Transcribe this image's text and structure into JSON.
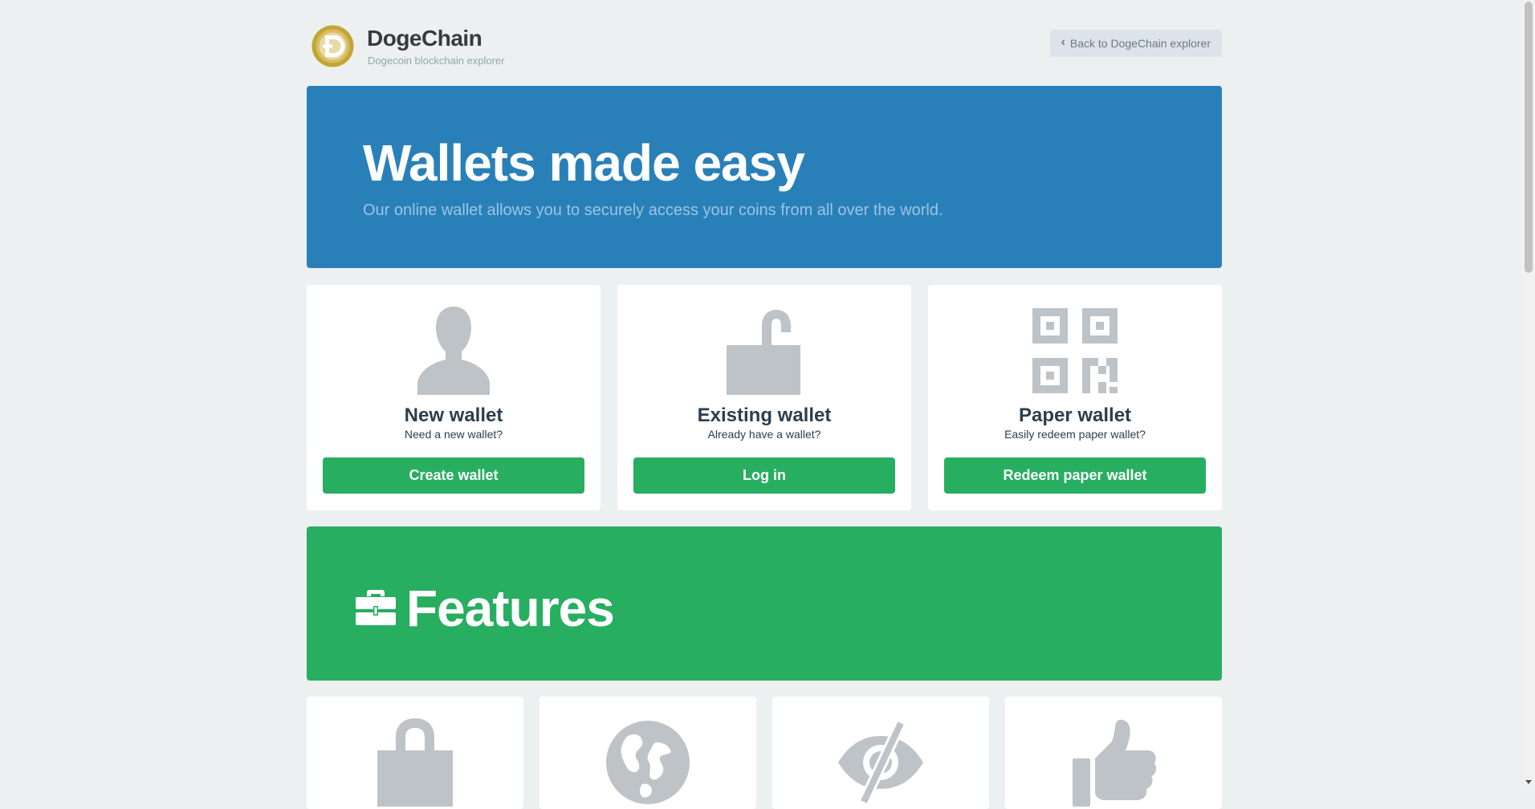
{
  "header": {
    "brand_name": "DogeChain",
    "brand_subtitle": "Dogecoin blockchain explorer",
    "back_link": "Back to DogeChain explorer"
  },
  "hero": {
    "title": "Wallets made easy",
    "subtitle": "Our online wallet allows you to securely access your coins from all over the world."
  },
  "cards": [
    {
      "icon": "user-icon",
      "title": "New wallet",
      "subtitle": "Need a new wallet?",
      "button": "Create wallet"
    },
    {
      "icon": "unlock-icon",
      "title": "Existing wallet",
      "subtitle": "Already have a wallet?",
      "button": "Log in"
    },
    {
      "icon": "qrcode-icon",
      "title": "Paper wallet",
      "subtitle": "Easily redeem paper wallet?",
      "button": "Redeem paper wallet"
    }
  ],
  "features": {
    "title": "Features",
    "icon": "briefcase-icon",
    "tiles": [
      "lock-icon",
      "globe-icon",
      "eye-slash-icon",
      "thumbs-up-icon"
    ]
  },
  "colors": {
    "background": "#ecf0f1",
    "hero": "#2980b9",
    "green": "#27ae60",
    "icon_gray": "#bdc3c7",
    "text_dark": "#2c3e50"
  }
}
